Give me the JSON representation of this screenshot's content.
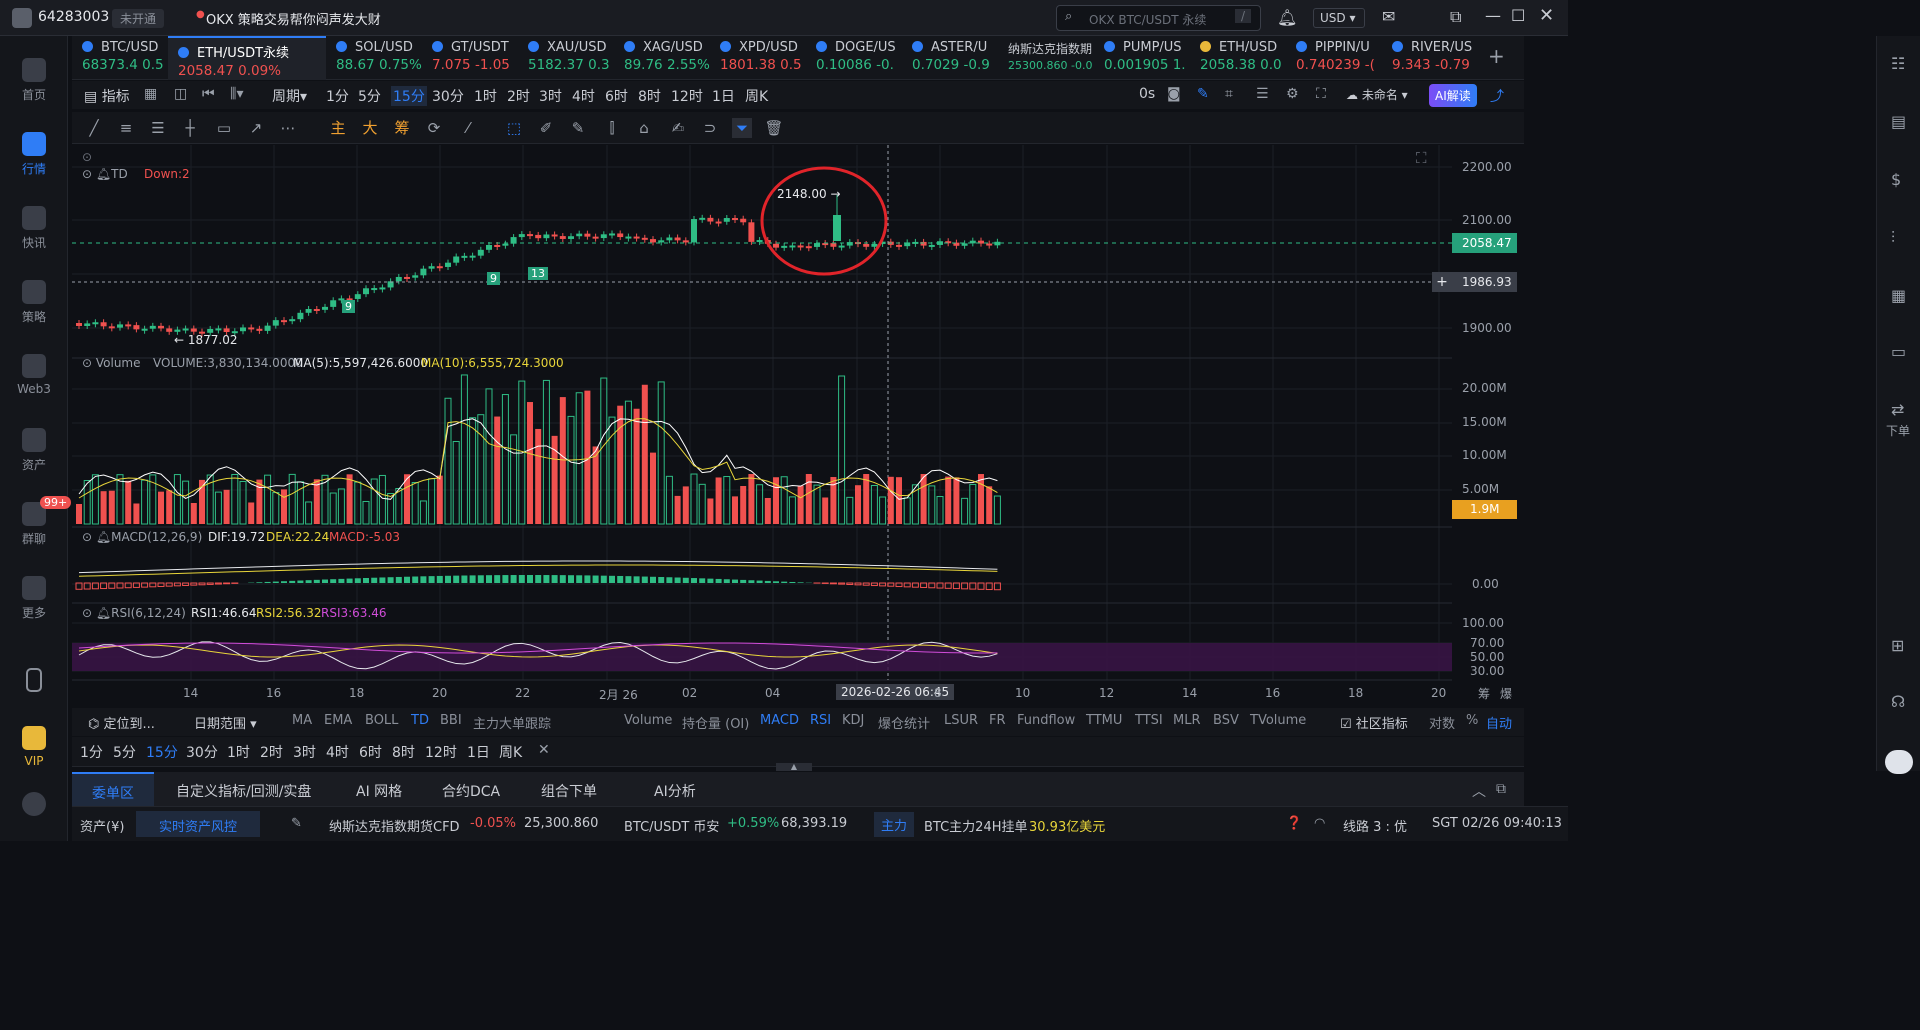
{
  "topbar": {
    "account": "64283003",
    "verify": "未开通",
    "announce": "OKX 策略交易帮你闷声发大财",
    "search_placeholder": "OKX BTC/USDT 永续",
    "search_key": "/",
    "currency": "USD"
  },
  "leftnav": [
    "首页",
    "行情",
    "快讯",
    "策略",
    "Web3",
    "资产",
    "群聊",
    "更多",
    "VIP"
  ],
  "leftnav_badge": "99+",
  "rightnav": {
    "order": "下单"
  },
  "tickers": [
    {
      "name": "BTC/USD",
      "price": "68373.4",
      "chg": "0.5",
      "dir": "up"
    },
    {
      "name": "ETH/USDT永续",
      "price": "2058.47",
      "chg": "0.09%",
      "dir": "dn"
    },
    {
      "name": "SOL/USD",
      "price": "88.67",
      "chg": "0.75%",
      "dir": "up"
    },
    {
      "name": "GT/USDT",
      "price": "7.075",
      "chg": "-1.05",
      "dir": "dn"
    },
    {
      "name": "XAU/USD",
      "price": "5182.37",
      "chg": "0.3",
      "dir": "up"
    },
    {
      "name": "XAG/USD",
      "price": "89.76",
      "chg": "2.55%",
      "dir": "up"
    },
    {
      "name": "XPD/USD",
      "price": "1801.38",
      "chg": "0.5",
      "dir": "dn"
    },
    {
      "name": "DOGE/US",
      "price": "0.10086",
      "chg": "-0.",
      "dir": "up"
    },
    {
      "name": "ASTER/U",
      "price": "0.7029",
      "chg": "-0.9",
      "dir": "up"
    },
    {
      "name": "纳斯达克指数期",
      "price": "25300.860",
      "chg": "-0.0",
      "dir": "up"
    },
    {
      "name": "PUMP/US",
      "price": "0.001905",
      "chg": "1.",
      "dir": "up"
    },
    {
      "name": "ETH/USD",
      "price": "2058.38",
      "chg": "0.0",
      "dir": "up"
    },
    {
      "name": "PIPPIN/U",
      "price": "0.740239",
      "chg": "-(",
      "dir": "dn"
    },
    {
      "name": "RIVER/US",
      "price": "9.343",
      "chg": "-0.79",
      "dir": "dn"
    }
  ],
  "timeframes": [
    "指标",
    "周期",
    "1分",
    "5分",
    "15分",
    "30分",
    "1时",
    "2时",
    "3时",
    "4时",
    "6时",
    "8时",
    "12时",
    "1日",
    "周K"
  ],
  "tf_selected": "15分",
  "toolbar_right": {
    "timer": "0s",
    "layout": "未命名",
    "ai": "AI解读"
  },
  "draw_tools": [
    "主",
    "大",
    "筹"
  ],
  "chart": {
    "td_label": "TD",
    "td_down": "Down:2",
    "high_label": "2148.00 →",
    "low_label": "← 1877.02",
    "td_marks": [
      "9",
      "9",
      "13"
    ],
    "price_ticks": [
      "2200.00",
      "2100.00",
      "1900.00"
    ],
    "current_price": "2058.47",
    "cross_price": "1986.93",
    "volume_label": "Volume",
    "vol_value": "VOLUME:3,830,134.0000",
    "ma5": "MA(5):5,597,426.6000",
    "ma10": "MA(10):6,555,724.3000",
    "vol_ticks": [
      "20.00M",
      "15.00M",
      "10.00M",
      "5.00M"
    ],
    "vol_current": "1.9M",
    "macd_label": "MACD(12,26,9)",
    "dif": "DIF:19.72",
    "dea": "DEA:22.24",
    "macd": "MACD:-5.03",
    "macd_tick": "0.00",
    "rsi_label": "RSI(6,12,24)",
    "rsi1": "RSI1:46.64",
    "rsi2": "RSI2:56.32",
    "rsi3": "RSI3:63.46",
    "rsi_ticks": [
      "100.00",
      "70.00",
      "50.00",
      "30.00"
    ],
    "x_ticks": [
      "14",
      "16",
      "18",
      "20",
      "22",
      "2月 26",
      "02",
      "04",
      "8",
      "10",
      "12",
      "14",
      "16",
      "18",
      "20"
    ],
    "cross_time": "2026-02-26 06:45",
    "axis_right_icons": [
      "筹",
      "爆"
    ]
  },
  "indicators": [
    "定位到...",
    "日期范围",
    "MA",
    "EMA",
    "BOLL",
    "TD",
    "BBI",
    "主力大单跟踪",
    "Volume",
    "持仓量 (OI)",
    "MACD",
    "RSI",
    "KDJ",
    "爆仓统计",
    "LSUR",
    "FR",
    "Fundflow",
    "TTMU",
    "TTSI",
    "MLR",
    "BSV",
    "TVolume",
    "社区指标",
    "对数",
    "%",
    "自动"
  ],
  "tf2": [
    "1分",
    "5分",
    "15分",
    "30分",
    "1时",
    "2时",
    "3时",
    "4时",
    "6时",
    "8时",
    "12时",
    "1日",
    "周K"
  ],
  "bottom_tabs": [
    "委单区",
    "自定义指标/回测/实盘",
    "AI 网格",
    "合约DCA",
    "组合下单",
    "AI分析"
  ],
  "status": {
    "asset": "资产(¥)",
    "risk": "实时资产风控",
    "nasdaq": "纳斯达克指数期货CFD",
    "nasdaq_chg": "-0.05%",
    "nasdaq_val": "25,300.860",
    "btc": "BTC/USDT 币安",
    "btc_chg": "+0.59%",
    "btc_val": "68,393.19",
    "zhuli": "主力",
    "order_text": "BTC主力24H挂单",
    "order_val": "30.93亿美元",
    "line": "线路 3 : 优",
    "time": "SGT 02/26 09:40:13"
  },
  "colors": {
    "up": "#2fbd85",
    "down": "#f0514f",
    "accent": "#2f7df6",
    "ma5": "#ffffff",
    "ma10": "#e8d53a",
    "rsi3": "#d04dd8"
  }
}
